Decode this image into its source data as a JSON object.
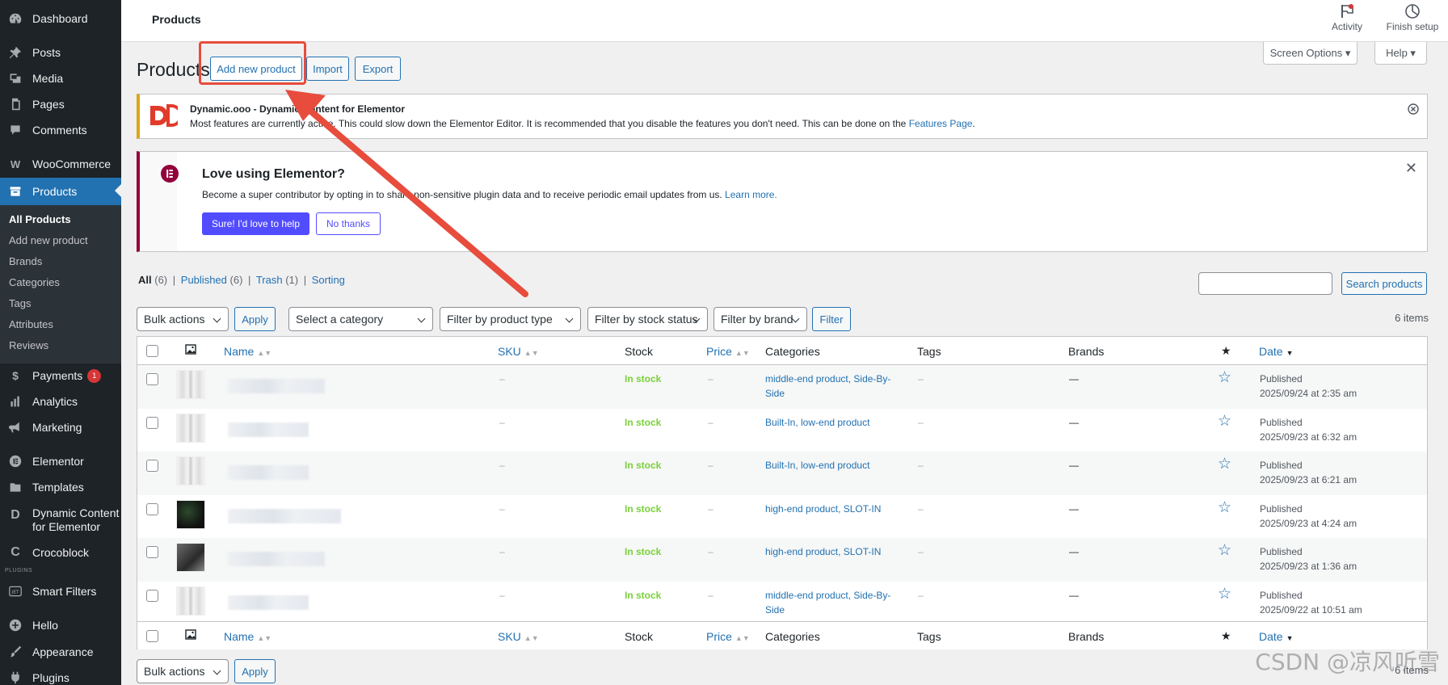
{
  "sidebar": {
    "items": [
      {
        "label": "Dashboard",
        "icon": "dashboard-icon"
      },
      {
        "label": "Posts",
        "icon": "pin-icon"
      },
      {
        "label": "Media",
        "icon": "media-icon"
      },
      {
        "label": "Pages",
        "icon": "pages-icon"
      },
      {
        "label": "Comments",
        "icon": "comment-icon"
      },
      {
        "label": "WooCommerce",
        "icon": "woo-icon"
      },
      {
        "label": "Products",
        "icon": "archive-icon"
      },
      {
        "label": "Payments",
        "icon": "payments-icon",
        "badge": "1"
      },
      {
        "label": "Analytics",
        "icon": "chart-icon"
      },
      {
        "label": "Marketing",
        "icon": "megaphone-icon"
      },
      {
        "label": "Elementor",
        "icon": "elementor-icon"
      },
      {
        "label": "Templates",
        "icon": "folder-icon"
      },
      {
        "label": "Dynamic Content",
        "label2": "for Elementor",
        "icon": "dce-icon"
      },
      {
        "label": "Crocoblock",
        "icon": "crocoblock-icon"
      },
      {
        "label": "Smart Filters",
        "icon": "jet-icon"
      },
      {
        "label": "Hello",
        "icon": "plus-icon"
      },
      {
        "label": "Appearance",
        "icon": "brush-icon"
      },
      {
        "label": "Plugins",
        "icon": "plug-icon"
      }
    ],
    "submenu": [
      "All Products",
      "Add new product",
      "Brands",
      "Categories",
      "Tags",
      "Attributes",
      "Reviews"
    ],
    "plugins_tag": "PLUGINS"
  },
  "topbar": {
    "title": "Products",
    "activity": "Activity",
    "finish": "Finish setup"
  },
  "heading": {
    "title": "Products",
    "add_new": "Add new product",
    "import": "Import",
    "export": "Export",
    "screen_options": "Screen Options ▾",
    "help": "Help ▾"
  },
  "notice1": {
    "title": "Dynamic.ooo - Dynamic Content for Elementor",
    "text": "Most features are currently active. This could slow down the Elementor Editor. It is recommended that you disable the features you don't need. This can be done on the",
    "link": "Features Page",
    "period": "."
  },
  "notice2": {
    "title": "Love using Elementor?",
    "text": "Become a super contributor by opting in to share non-sensitive plugin data and to receive periodic email updates from us.",
    "link": "Learn more.",
    "yes": "Sure! I'd love to help",
    "no": "No thanks"
  },
  "filters": {
    "all": "All",
    "all_count": "(6)",
    "published": "Published",
    "published_count": "(6)",
    "trash": "Trash",
    "trash_count": "(1)",
    "sorting": "Sorting",
    "sep": "|",
    "search_btn": "Search products",
    "bulk": "Bulk actions",
    "apply": "Apply",
    "category": "Select a category",
    "type": "Filter by product type",
    "stock": "Filter by stock status",
    "brand": "Filter by brand",
    "filter": "Filter",
    "items": "6 items",
    "items_bottom": "6 items"
  },
  "table": {
    "headers": {
      "name": "Name",
      "sku": "SKU",
      "stock": "Stock",
      "price": "Price",
      "categories": "Categories",
      "tags": "Tags",
      "brands": "Brands",
      "date": "Date"
    },
    "rows": [
      {
        "sku": "–",
        "stock": "In stock",
        "price": "–",
        "cat1": "middle-end product, Side-By-",
        "cat2": "Side",
        "tags": "–",
        "brands": "—",
        "status": "Published",
        "date": "2025/09/24 at 2:35 am",
        "thumb": "fridge"
      },
      {
        "sku": "–",
        "stock": "In stock",
        "price": "–",
        "cat1": "Built-In, low-end product",
        "cat2": "",
        "tags": "–",
        "brands": "—",
        "status": "Published",
        "date": "2025/09/23 at 6:32 am",
        "thumb": "fridge"
      },
      {
        "sku": "–",
        "stock": "In stock",
        "price": "–",
        "cat1": "Built-In, low-end product",
        "cat2": "",
        "tags": "–",
        "brands": "—",
        "status": "Published",
        "date": "2025/09/23 at 6:21 am",
        "thumb": "fridge"
      },
      {
        "sku": "–",
        "stock": "In stock",
        "price": "–",
        "cat1": "high-end product, SLOT-IN",
        "cat2": "",
        "tags": "–",
        "brands": "—",
        "status": "Published",
        "date": "2025/09/23 at 4:24 am",
        "thumb": "dark"
      },
      {
        "sku": "–",
        "stock": "In stock",
        "price": "–",
        "cat1": "high-end product, SLOT-IN",
        "cat2": "",
        "tags": "–",
        "brands": "—",
        "status": "Published",
        "date": "2025/09/23 at 1:36 am",
        "thumb": "kitchen"
      },
      {
        "sku": "–",
        "stock": "In stock",
        "price": "–",
        "cat1": "middle-end product, Side-By-",
        "cat2": "Side",
        "tags": "–",
        "brands": "—",
        "status": "Published",
        "date": "2025/09/22 at 10:51 am",
        "thumb": "fridge"
      }
    ]
  },
  "watermark": "CSDN @凉风听雪",
  "colors": {
    "accent": "#2271b1",
    "sidebar": "#1d2327",
    "instock": "#7ad03a",
    "annotation": "#e74c3c",
    "elementor": "#92003b",
    "elementor_btn": "#524cff"
  }
}
